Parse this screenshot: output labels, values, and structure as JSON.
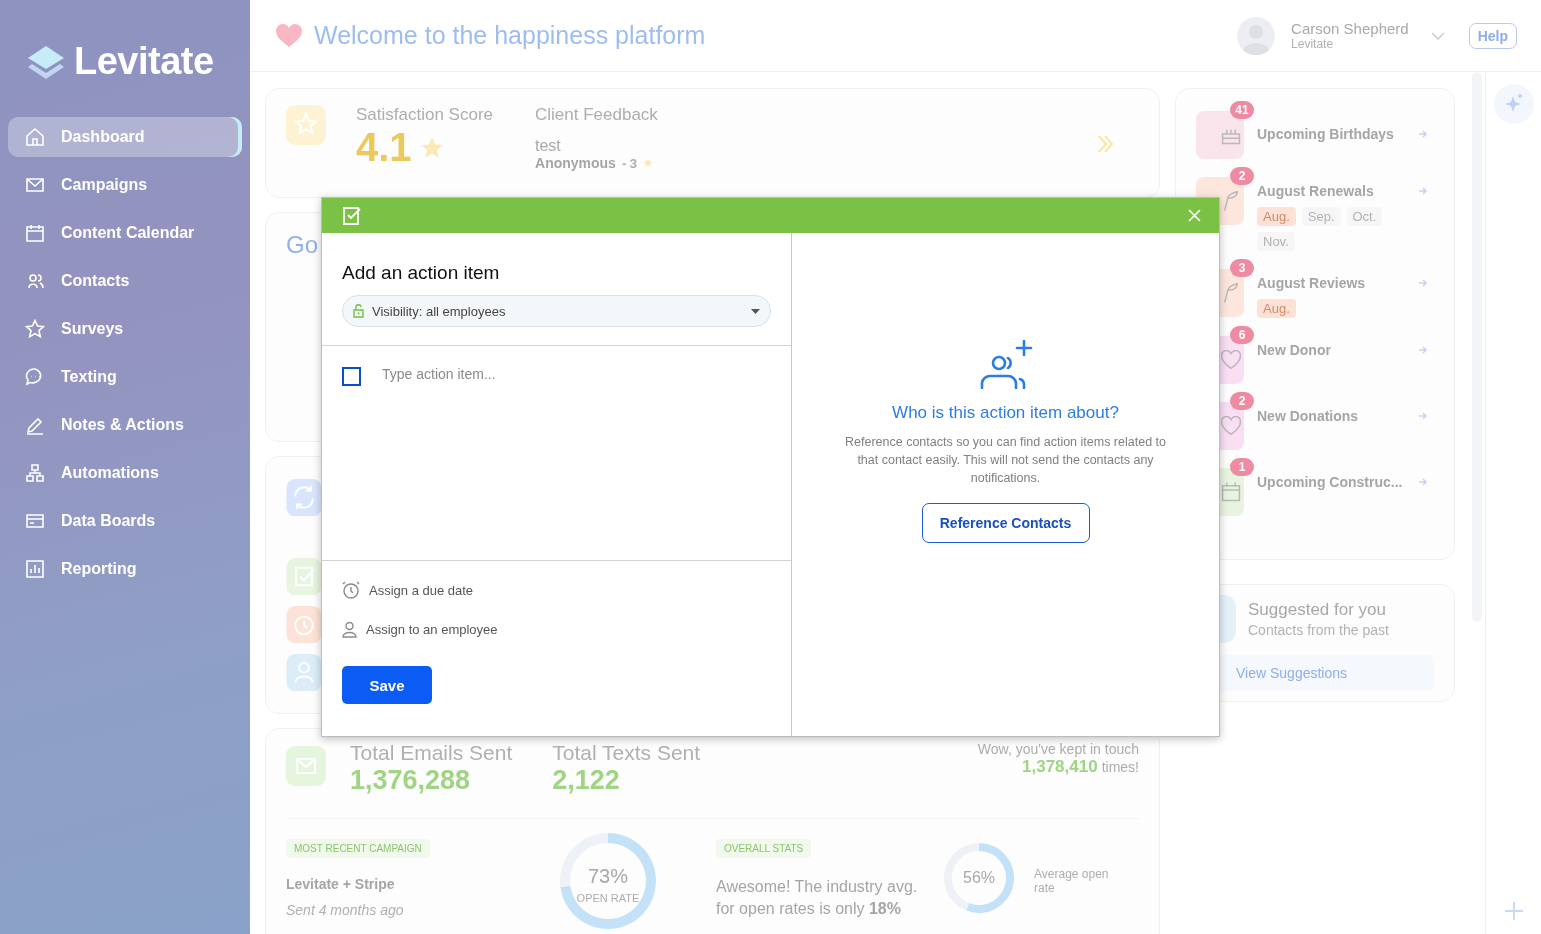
{
  "sidebar": {
    "logo": "Levitate",
    "items": [
      {
        "label": "Dashboard",
        "selected": true
      },
      {
        "label": "Campaigns",
        "selected": false
      },
      {
        "label": "Content Calendar",
        "selected": false
      },
      {
        "label": "Contacts",
        "selected": false
      },
      {
        "label": "Surveys",
        "selected": false
      },
      {
        "label": "Texting",
        "selected": false
      },
      {
        "label": "Notes & Actions",
        "selected": false
      },
      {
        "label": "Automations",
        "selected": false
      },
      {
        "label": "Data Boards",
        "selected": false
      },
      {
        "label": "Reporting",
        "selected": false
      }
    ]
  },
  "header": {
    "title": "Welcome to the happiness platform",
    "user_name": "Carson Shepherd",
    "user_org": "Levitate",
    "help": "Help"
  },
  "satisfaction": {
    "label": "Satisfaction Score",
    "score": "4.1",
    "feedback_label": "Client Feedback",
    "feedback": "test",
    "author": "Anonymous",
    "rating": "- 3"
  },
  "partner_card": {
    "logo_text": "Go"
  },
  "reminders": [
    {
      "title": "Upcoming Birthdays",
      "count": "41",
      "color": "#f9e4ec"
    },
    {
      "title": "August Renewals",
      "count": "2",
      "color": "#fde7dd",
      "months": [
        {
          "label": "Aug.",
          "selected": true
        },
        {
          "label": "Sep.",
          "selected": false
        },
        {
          "label": "Oct.",
          "selected": false
        },
        {
          "label": "Nov.",
          "selected": false
        }
      ]
    },
    {
      "title": "August Reviews",
      "count": "3",
      "color": "#fde7dd",
      "months": [
        {
          "label": "Aug.",
          "selected": true
        }
      ]
    },
    {
      "title": "New Donor",
      "count": "6",
      "color": "#f9def4"
    },
    {
      "title": "New Donations",
      "count": "2",
      "color": "#f9def4"
    },
    {
      "title": "Upcoming Construc...",
      "count": "1",
      "color": "#e9f4e0"
    }
  ],
  "suggested": {
    "title": "Suggested for you",
    "subtitle": "Contacts from the past",
    "button": "View Suggestions"
  },
  "stats": {
    "emails_label": "Total Emails Sent",
    "emails": "1,376,288",
    "texts_label": "Total Texts Sent",
    "texts": "2,122",
    "touch_text": "Wow, you've kept in touch",
    "touch_count": "1,378,410",
    "touch_suffix": "times!",
    "campaign": {
      "tag": "MOST RECENT CAMPAIGN",
      "name": "Levitate + Stripe",
      "sent": "Sent 4 months ago",
      "rate": "73%",
      "rate_label": "OPEN RATE",
      "chart_data": {
        "type": "donut",
        "values": [
          73,
          27
        ]
      }
    },
    "overall": {
      "tag": "OVERALL STATS",
      "text": "Awesome! The industry avg. for open rates is only **18%**",
      "rate": "56%",
      "rate_label": "Average open rate",
      "chart_data": {
        "type": "donut",
        "values": [
          56,
          44
        ]
      }
    }
  },
  "modal": {
    "title": "Add an action item",
    "visibility": "Visibility: all employees",
    "item_placeholder": "Type action item...",
    "item_checked": false,
    "due": "Assign a due date",
    "assign": "Assign to an employee",
    "save": "Save",
    "about_title": "Who is this action item about?",
    "about_text": "Reference contacts so you can find action items related to that contact easily. This will not send the contacts any notifications.",
    "reference_button": "Reference Contacts"
  }
}
